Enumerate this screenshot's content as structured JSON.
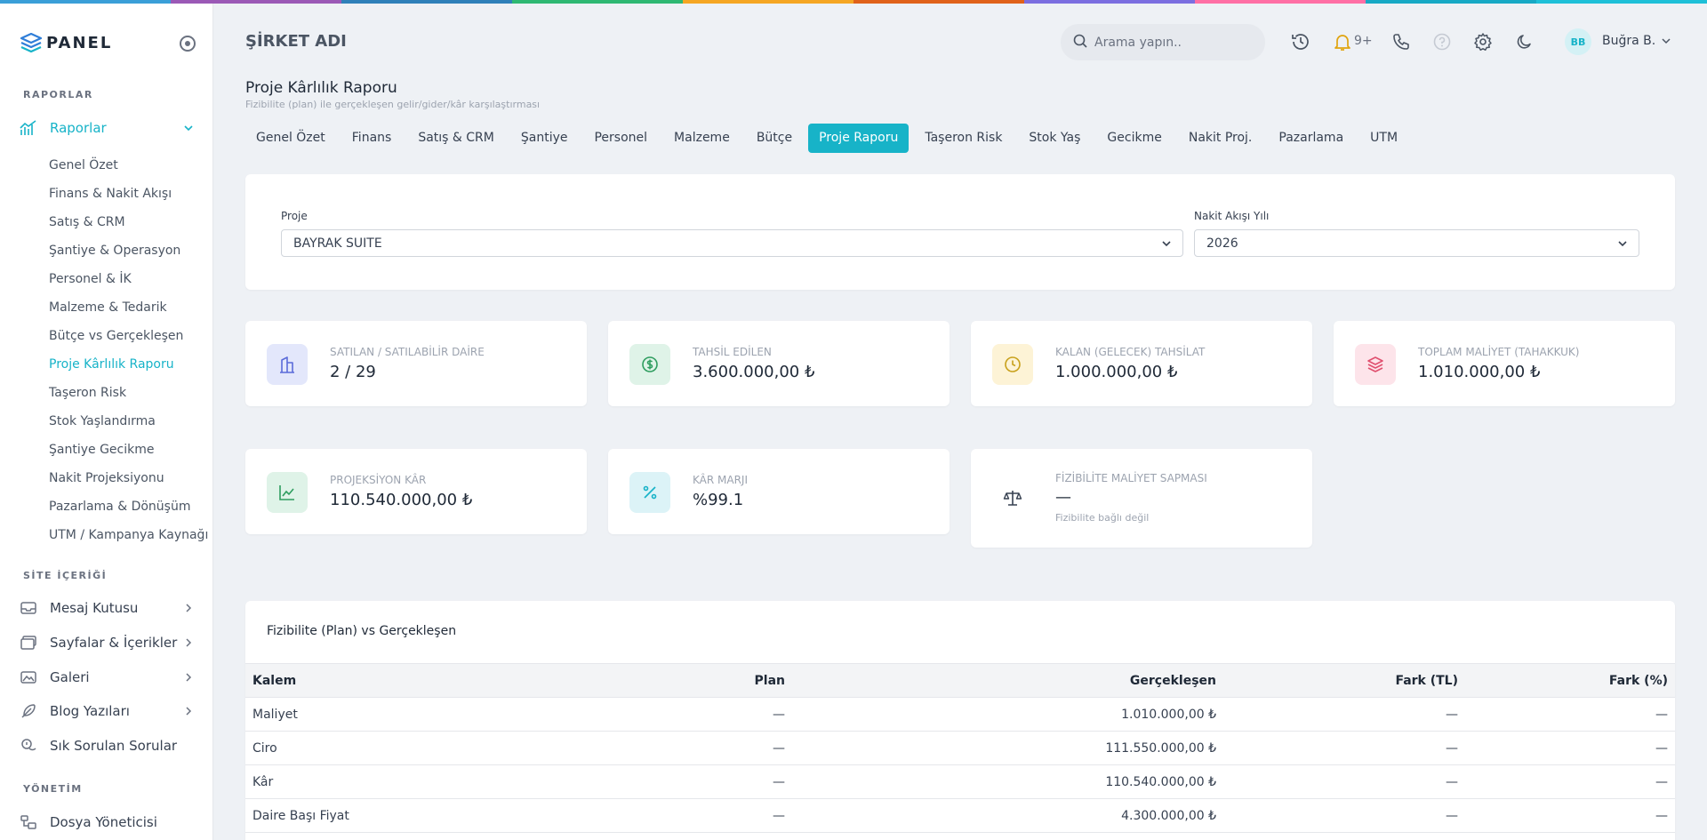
{
  "colors": {
    "accent": "#17b3c8",
    "rainbow": [
      "#3498db",
      "#9b59b6",
      "#2980b9",
      "#27ae60",
      "#f39c12",
      "#e67e22",
      "#6c5ce7",
      "#ff6b9d",
      "#16a3c5",
      "#00bcd4"
    ]
  },
  "app": {
    "logo_text": "PANEL",
    "company": "ŞİRKET ADI"
  },
  "sidebar": {
    "sections": {
      "reports": "RAPORLAR",
      "site_content": "SİTE İÇERİĞİ",
      "management": "YÖNETİM"
    },
    "reports_parent": {
      "label": "Raporlar",
      "icon": "chart-icon"
    },
    "report_items": [
      "Genel Özet",
      "Finans & Nakit Akışı",
      "Satış & CRM",
      "Şantiye & Operasyon",
      "Personel & İK",
      "Malzeme & Tedarik",
      "Bütçe vs Gerçekleşen",
      "Proje Kârlılık Raporu",
      "Taşeron Risk",
      "Stok Yaşlandırma",
      "Şantiye Gecikme",
      "Nakit Projeksiyonu",
      "Pazarlama & Dönüşüm",
      "UTM / Kampanya Kaynağı"
    ],
    "active_report": "Proje Kârlılık Raporu",
    "content_items": [
      {
        "label": "Mesaj Kutusu",
        "icon": "inbox-icon"
      },
      {
        "label": "Sayfalar & İçerikler",
        "icon": "pages-icon"
      },
      {
        "label": "Galeri",
        "icon": "gallery-icon"
      },
      {
        "label": "Blog Yazıları",
        "icon": "feather-icon"
      },
      {
        "label": "Sık Sorulan Sorular",
        "icon": "faq-icon"
      }
    ],
    "management_items": [
      {
        "label": "Dosya Yöneticisi",
        "icon": "folder-tree-icon"
      }
    ]
  },
  "header": {
    "search_placeholder": "Arama yapın..",
    "notification_count": "9+",
    "user_initials": "BB",
    "user_name": "Buğra B."
  },
  "page": {
    "title": "Proje Kârlılık Raporu",
    "subtitle": "Fizibilite (plan) ile gerçekleşen gelir/gider/kâr karşılaştırması"
  },
  "tabs": [
    "Genel Özet",
    "Finans",
    "Satış & CRM",
    "Şantiye",
    "Personel",
    "Malzeme",
    "Bütçe",
    "Proje Raporu",
    "Taşeron Risk",
    "Stok Yaş",
    "Gecikme",
    "Nakit Proj.",
    "Pazarlama",
    "UTM"
  ],
  "active_tab": "Proje Raporu",
  "filters": {
    "project_label": "Proje",
    "project_value": "BAYRAK SUITE",
    "year_label": "Nakit Akışı Yılı",
    "year_value": "2026"
  },
  "stats": [
    {
      "label": "SATILAN / SATILABİLİR DAİRE",
      "value": "2 / 29",
      "icon": "building-icon",
      "bg": "#e3e7fb",
      "fg": "#5b6bd9"
    },
    {
      "label": "TAHSİL EDİLEN",
      "value": "3.600.000,00 ₺",
      "icon": "dollar-circle-icon",
      "bg": "#dff3e8",
      "fg": "#2e9d5f"
    },
    {
      "label": "KALAN (GELECEK) TAHSİLAT",
      "value": "1.000.000,00 ₺",
      "icon": "clock-icon",
      "bg": "#fdf3d6",
      "fg": "#c8a01a"
    },
    {
      "label": "TOPLAM MALİYET (TAHAKKUK)",
      "value": "1.010.000,00 ₺",
      "icon": "layers-icon",
      "bg": "#fde4ea",
      "fg": "#e0506f"
    },
    {
      "label": "PROJEKSİYON KÂR",
      "value": "110.540.000,00 ₺",
      "icon": "line-chart-icon",
      "bg": "#dff3e8",
      "fg": "#2e9d5f"
    },
    {
      "label": "KÂR MARJI",
      "value": "%99.1",
      "icon": "percent-icon",
      "bg": "#dcf3f7",
      "fg": "#17b3c8"
    },
    {
      "label": "FİZİBİLİTE MALİYET SAPMASI",
      "value": "—",
      "note": "Fizibilite bağlı değil",
      "icon": "scale-icon",
      "bg": "#ffffff",
      "fg": "#374151"
    }
  ],
  "table": {
    "title": "Fizibilite (Plan) vs Gerçekleşen",
    "columns": [
      "Kalem",
      "Plan",
      "Gerçekleşen",
      "Fark (TL)",
      "Fark (%)"
    ],
    "rows": [
      [
        "Maliyet",
        "—",
        "1.010.000,00 ₺",
        "—",
        "—"
      ],
      [
        "Ciro",
        "—",
        "111.550.000,00 ₺",
        "—",
        "—"
      ],
      [
        "Kâr",
        "—",
        "110.540.000,00 ₺",
        "—",
        "—"
      ],
      [
        "Daire Başı Fiyat",
        "—",
        "4.300.000,00 ₺",
        "—",
        "—"
      ]
    ]
  }
}
